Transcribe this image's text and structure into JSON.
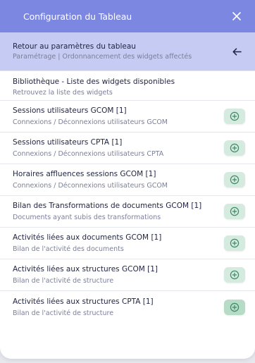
{
  "header": {
    "title": "Configuration du Tableau",
    "close_icon": "close-icon"
  },
  "back": {
    "title": "Retour au paramètres du tableau",
    "subtitle": "Paramétrage | Ordonnancement des widgets affectés",
    "icon": "arrow-left-icon"
  },
  "library": {
    "title": "Bibliothèque - Liste des widgets disponibles",
    "subtitle": "Retrouvez la liste des widgets"
  },
  "widgets": [
    {
      "title": "Sessions utilisateurs GCOM  [1]",
      "subtitle": "Connexions / Déconnexions utilisateurs GCOM"
    },
    {
      "title": "Sessions utilisateurs CPTA  [1]",
      "subtitle": "Connexions / Déconnexions utilisateurs CPTA"
    },
    {
      "title": "Horaires affluences sessions GCOM  [1]",
      "subtitle": "Connexions / Déconnexions utilisateurs GCOM"
    },
    {
      "title": "Bilan des Transformations de documents GCOM  [1]",
      "subtitle": "Documents ayant subis des transformations"
    },
    {
      "title": "Activités liées aux documents GCOM  [1]",
      "subtitle": "Bilan de l'activité des documents"
    },
    {
      "title": "Activités liées aux structures GCOM  [1]",
      "subtitle": "Bilan de l'activité de structure"
    },
    {
      "title": "Activités liées aux structures CPTA  [1]",
      "subtitle": "Bilan de l'activité de structure"
    }
  ],
  "add_icon": "plus-circle-icon",
  "colors": {
    "header_bg": "#7c87e2",
    "back_row_bg": "#c6cbf3",
    "add_button_bg": "#d6ebe0",
    "add_icon": "#3f8a66"
  }
}
